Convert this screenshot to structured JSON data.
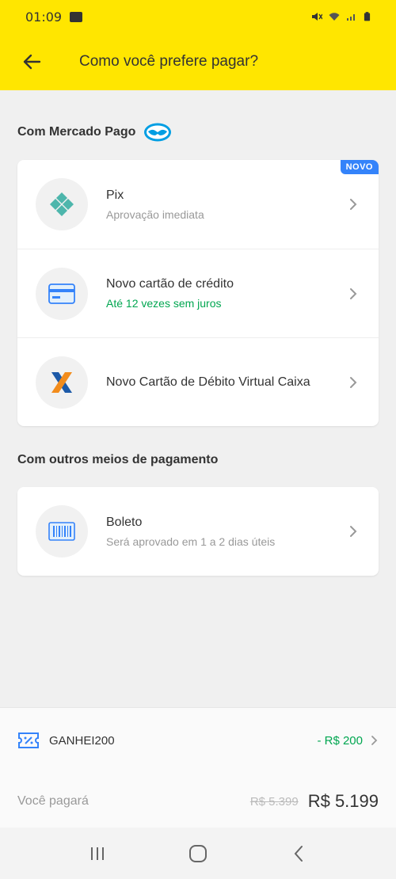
{
  "status_bar": {
    "time": "01:09"
  },
  "app_bar": {
    "title": "Como você prefere pagar?"
  },
  "section_mp": {
    "title": "Com Mercado Pago"
  },
  "mp_methods": [
    {
      "title": "Pix",
      "subtitle": "Aprovação imediata",
      "badge": "NOVO",
      "icon": "pix-icon"
    },
    {
      "title": "Novo cartão de crédito",
      "subtitle": "Até 12 vezes sem juros",
      "icon": "credit-card-icon"
    },
    {
      "title": "Novo Cartão de Débito Virtual Caixa",
      "icon": "caixa-logo-icon"
    }
  ],
  "section_other": {
    "title": "Com outros meios de pagamento"
  },
  "other_methods": [
    {
      "title": "Boleto",
      "subtitle": "Será aprovado em 1 a 2 dias úteis",
      "icon": "barcode-icon"
    }
  ],
  "coupon": {
    "code": "GANHEI200",
    "discount": "- R$ 200"
  },
  "payment": {
    "label": "Você pagará",
    "old_price": "R$ 5.399",
    "total": "R$ 5.199"
  },
  "colors": {
    "brand_yellow": "#ffe600",
    "accent_blue": "#3483fa",
    "success_green": "#00a650",
    "pix_teal": "#4db6ac",
    "caixa_blue": "#1d5aa8",
    "caixa_orange": "#f28c1c"
  }
}
